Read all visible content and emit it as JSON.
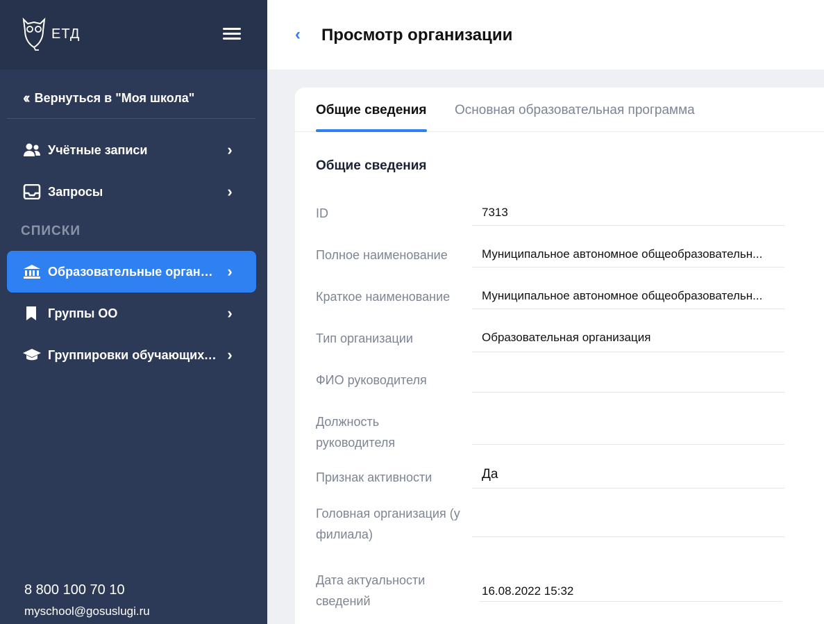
{
  "app": {
    "logo_text": "ЕТД"
  },
  "sidebar": {
    "back_label": "Вернуться в \"Моя школа\"",
    "items_top": [
      {
        "label": "Учётные записи",
        "icon": "users-icon"
      },
      {
        "label": "Запросы",
        "icon": "inbox-icon"
      }
    ],
    "section_label": "СПИСКИ",
    "items_lists": [
      {
        "label": "Образовательные организа...",
        "icon": "institution-icon",
        "active": true
      },
      {
        "label": "Группы ОО",
        "icon": "bookmark-icon"
      },
      {
        "label": "Группировки обучающихся",
        "icon": "graduation-cap-icon"
      }
    ],
    "phone": "8 800 100 70 10",
    "email": "myschool@gosuslugi.ru"
  },
  "header": {
    "title": "Просмотр организации"
  },
  "tabs": [
    {
      "label": "Общие сведения",
      "active": true
    },
    {
      "label": "Основная образовательная программа",
      "active": false
    }
  ],
  "section_title": "Общие сведения",
  "fields": [
    {
      "label": "ID",
      "value": "7313"
    },
    {
      "label": "Полное наименование",
      "value": "Муниципальное автономное общеобразовательн..."
    },
    {
      "label": "Краткое наименование",
      "value": "Муниципальное автономное общеобразовательн..."
    },
    {
      "label": "Тип организации",
      "value": "Образовательная организация"
    },
    {
      "label": "ФИО руководителя",
      "value": ""
    },
    {
      "label_line1": "Должность",
      "label_line2": "руководителя",
      "value": ""
    },
    {
      "label": "Признак активности",
      "value": "Да"
    },
    {
      "label_line1": "Головная организация (у",
      "label_line2": "филиала)",
      "value": ""
    },
    {
      "label_line1": "Дата актуальности",
      "label_line2": "сведений",
      "value": "16.08.2022 15:32"
    }
  ],
  "colors": {
    "sidebar_bg": "#2c3a58",
    "accent": "#2f80f0"
  }
}
